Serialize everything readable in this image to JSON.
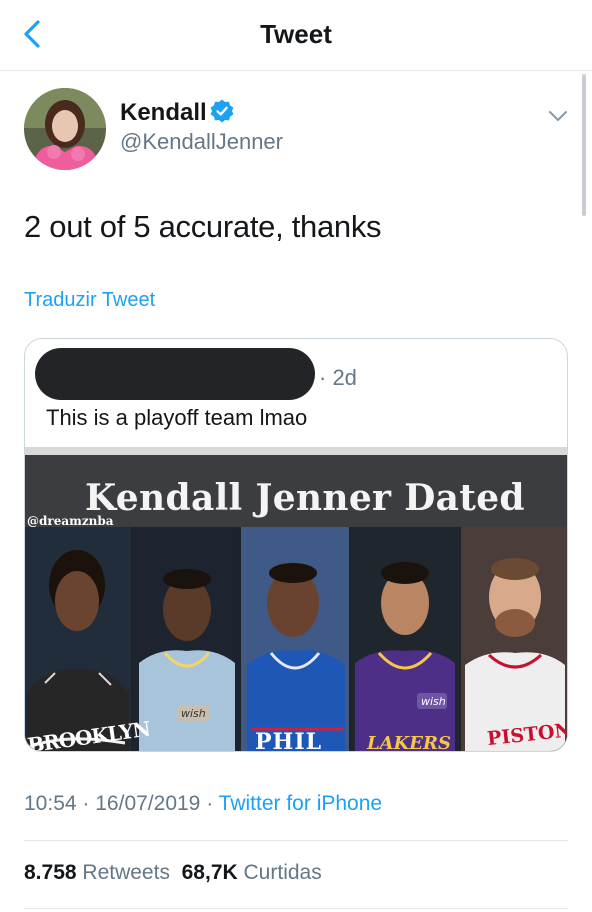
{
  "header": {
    "title": "Tweet",
    "back_icon": "chevron-left-icon"
  },
  "author": {
    "name": "Kendall",
    "handle": "@KendallJenner",
    "verified": true
  },
  "tweet": {
    "text": "2 out of 5 accurate, thanks",
    "translate_label": "Traduzir Tweet"
  },
  "quoted": {
    "time": "· 2d",
    "text": "This is a playoff team lmao",
    "image": {
      "title": "Kendall Jenner Dated",
      "watermark": "@dreamznba",
      "jersey_labels": [
        "BROOKLYN",
        "wish",
        "PHIL",
        "LAKERS",
        "wish",
        "PISTONS"
      ]
    }
  },
  "meta": {
    "time": "10:54",
    "date": "16/07/2019",
    "separator": "·",
    "source": "Twitter for iPhone"
  },
  "stats": {
    "retweets_count": "8.758",
    "retweets_label": "Retweets",
    "likes_count": "68,7K",
    "likes_label": "Curtidas"
  },
  "colors": {
    "accent": "#1da1f2",
    "secondary_text": "#657786",
    "border": "#e1e8ed"
  }
}
